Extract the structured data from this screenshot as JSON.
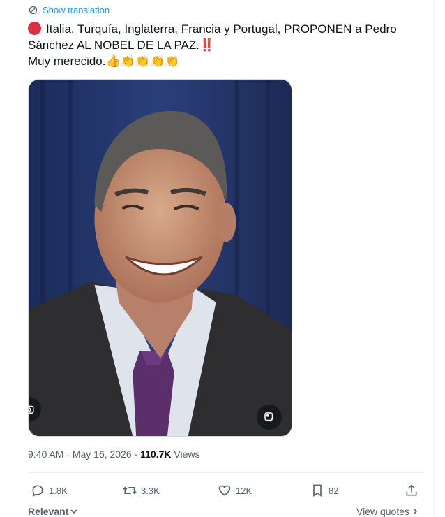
{
  "translation": {
    "label": "Show translation"
  },
  "tweet": {
    "line1": "Italia, Turquía, Inglaterra, Francia y Portugal, PROPONEN a Pedro",
    "line2": "Sánchez AL NOBEL DE LA PAZ.",
    "line2_emoji": "‼️",
    "line3": "Muy merecido.",
    "line3_emoji": "👍👏👏👏👏"
  },
  "media": {
    "alt": "Photo of a smiling man in a dark suit and purple tie against a blue curtain"
  },
  "meta": {
    "time": "9:40 AM",
    "separator": "·",
    "date": "May 16, 2026",
    "views_count": "110.7K",
    "views_label": "Views"
  },
  "actions": {
    "replies": "1.8K",
    "reposts": "3.3K",
    "likes": "12K",
    "bookmarks": "82"
  },
  "footer": {
    "relevant": "Relevant",
    "view_quotes": "View quotes"
  },
  "colors": {
    "accent": "#1d9bf0",
    "muted": "#536471",
    "text": "#0f1419"
  }
}
